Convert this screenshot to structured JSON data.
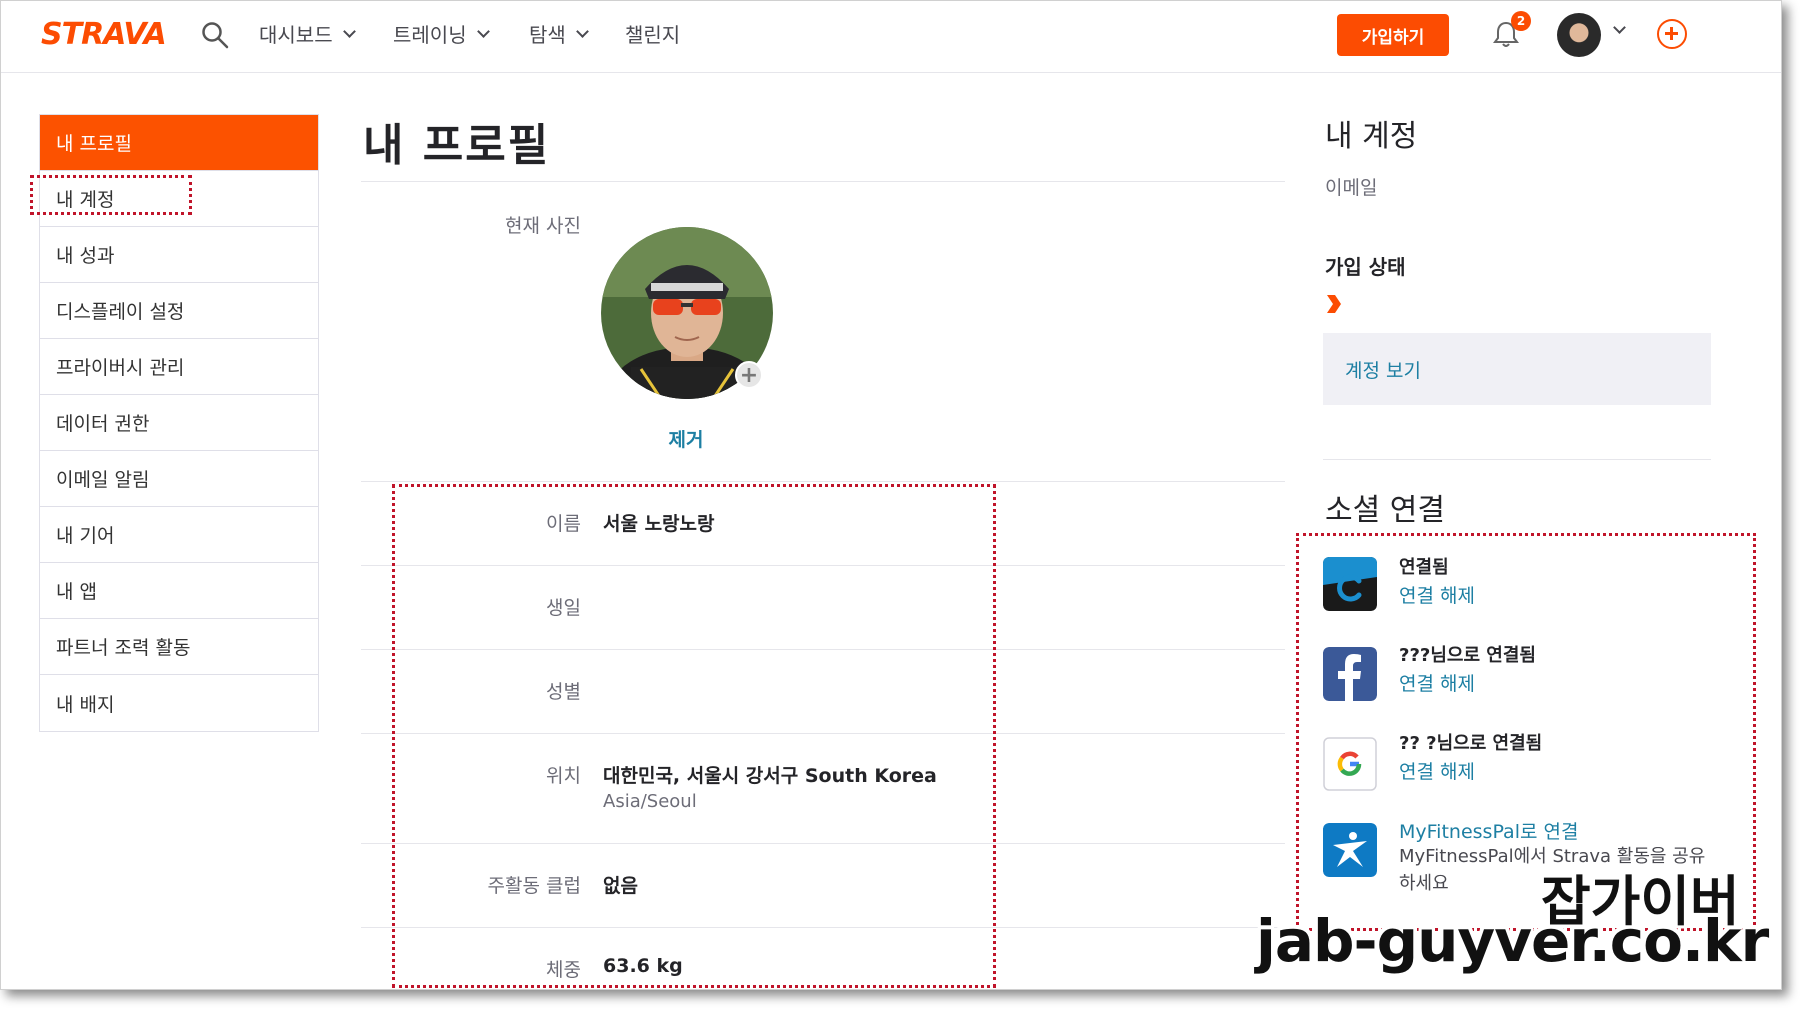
{
  "nav": {
    "logo": "STRAVA",
    "items": [
      "대시보드",
      "트레이닝",
      "탐색",
      "챌린지"
    ],
    "signup_label": "가입하기",
    "notification_count": "2"
  },
  "sidebar": {
    "items": [
      {
        "label": "내 프로필",
        "active": true
      },
      {
        "label": "내 계정"
      },
      {
        "label": "내 성과"
      },
      {
        "label": "디스플레이 설정"
      },
      {
        "label": "프라이버시 관리"
      },
      {
        "label": "데이터 권한"
      },
      {
        "label": "이메일 알림"
      },
      {
        "label": "내 기어"
      },
      {
        "label": "내 앱"
      },
      {
        "label": "파트너 조력 활동"
      },
      {
        "label": "내 배지"
      }
    ]
  },
  "main": {
    "title": "내 프로필",
    "photo_label": "현재 사진",
    "remove_label": "제거",
    "fields": {
      "name_label": "이름",
      "name_value": "서울 노랑노랑",
      "birthday_label": "생일",
      "gender_label": "성별",
      "location_label": "위치",
      "location_value": "대한민국, 서울시 강서구 South Korea",
      "timezone_value": "Asia/Seoul",
      "club_label": "주활동 클럽",
      "club_value": "없음",
      "weight_label": "체중",
      "weight_value": "63.6 kg"
    }
  },
  "account": {
    "title": "내 계정",
    "email_label": "이메일",
    "membership_label": "가입 상태",
    "view_account_label": "계정 보기"
  },
  "social": {
    "title": "소셜 연결",
    "connections": [
      {
        "app": "garmin-connect",
        "status": "연결됨",
        "action": "연결 해제"
      },
      {
        "app": "facebook",
        "status": "???님으로 연결됨",
        "action": "연결 해제"
      },
      {
        "app": "google",
        "status": "?? ?님으로 연결됨",
        "action": "연결 해제"
      },
      {
        "app": "myfitnesspal",
        "status": "MyFitnessPal로 연결",
        "description": "MyFitnessPal에서 Strava 활동을 공유하세요"
      }
    ]
  },
  "watermark": {
    "title": "잡가이버",
    "url": "jab-guyver.co.kr"
  },
  "colors": {
    "brand": "#fc4c02",
    "link": "#1d7fa3",
    "annotation": "#c0142a"
  }
}
